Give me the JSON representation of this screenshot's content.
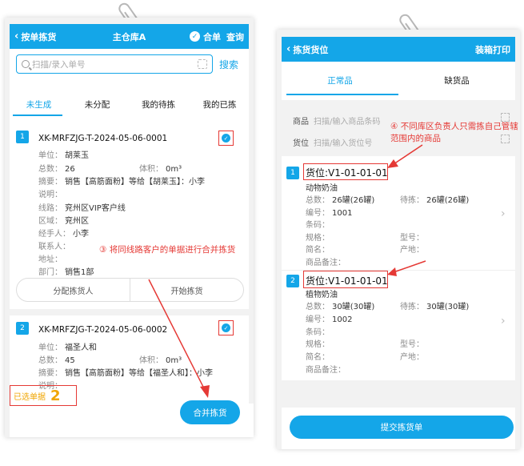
{
  "left": {
    "topbar": {
      "back": "按单拣货",
      "title": "主仓库A",
      "merge_check": "合单",
      "query": "查询"
    },
    "search": {
      "placeholder": "扫描/录入单号",
      "button": "搜索"
    },
    "tabs": [
      "未生成",
      "未分配",
      "我的待拣",
      "我的已拣"
    ],
    "active_tab": 0,
    "cards": [
      {
        "index": "1",
        "order_no": "XK-MRFZJG-T-2024-05-06-0001",
        "unit": "胡莱玉",
        "total": "26",
        "volume": "0m³",
        "summary": "销售【高筋面粉】等给【胡莱玉】：小李",
        "remark": "",
        "route": "兖州区VIP客户线",
        "region": "兖州区",
        "handler": "小李",
        "contact": "",
        "address": "",
        "dept": "销售1部"
      },
      {
        "index": "2",
        "order_no": "XK-MRFZJG-T-2024-05-06-0002",
        "unit": "福圣人和",
        "total": "45",
        "volume": "0m³",
        "summary": "销售【高筋面粉】等给【福圣人和】：小李",
        "remark": ""
      }
    ],
    "labels": {
      "unit": "单位：",
      "total": "总数：",
      "volume": "体积：",
      "summary": "摘要：",
      "remark": "说明：",
      "route": "线路：",
      "region": "区域：",
      "handler": "经手人：",
      "contact": "联系人：",
      "address": "地址：",
      "dept": "部门："
    },
    "actions": {
      "assign": "分配拣货人",
      "start": "开始拣货"
    },
    "footer": {
      "selected_label": "已选单据",
      "selected_count": "2",
      "merge_button": "合并拣货"
    },
    "annotation": "③ 将同线路客户的单据进行合并拣货"
  },
  "right": {
    "topbar": {
      "back": "拣货货位",
      "action": "装箱打印"
    },
    "tabs": [
      "正常品",
      "缺货品"
    ],
    "active_tab": 0,
    "scan": {
      "product_label": "商品",
      "product_placeholder": "扫描/输入商品条码",
      "location_label": "货位",
      "location_placeholder": "扫描/输入货位号"
    },
    "annotation": "④ 不同库区负责人只需拣自己管辖范围内的商品",
    "labels": {
      "total": "总数：",
      "to_pick": "待拣：",
      "code": "编号：",
      "barcode": "条码：",
      "spec": "规格：",
      "model": "型号：",
      "short_name": "简名：",
      "origin": "产地：",
      "remark": "商品备注："
    },
    "items": [
      {
        "index": "1",
        "location": "货位:V1-01-01-01",
        "name": "动物奶油",
        "total": "26罐(26罐)",
        "to_pick": "26罐(26罐)",
        "code": "1001"
      },
      {
        "index": "2",
        "location": "货位:V1-01-01-01",
        "name": "植物奶油",
        "total": "30罐(30罐)",
        "to_pick": "30罐(30罐)",
        "code": "1002"
      }
    ],
    "submit": "提交拣货单"
  },
  "colors": {
    "primary": "#14a6e8",
    "annotation": "#e53935",
    "highlight": "#f0a500"
  }
}
